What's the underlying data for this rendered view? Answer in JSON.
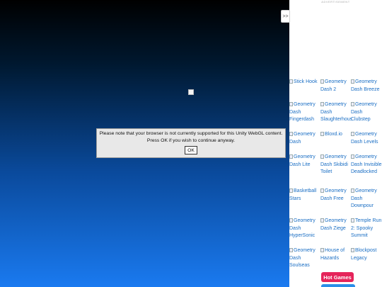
{
  "dialog": {
    "line1": "Please note that your browser is not currently supported for this Unity WebGL content.",
    "line2": "Press OK if you wish to continue anyway.",
    "ok_label": "OK"
  },
  "sidebar": {
    "toggle_label": ">>",
    "ad_label": "ADVERTISEMENT",
    "games": [
      "Stick Hook",
      "Geometry Dash 2",
      "Geometry Dash Breeze",
      "Geometry Dash Fingerdash",
      "Geometry Dash Slaughterhouse",
      "Geometry Dash Clubstep",
      "Geometry Dash",
      "Bloxd.io",
      "Geometry Dash Levels",
      "Geometry Dash Lite",
      "Geometry Dash Skibidi Toilet",
      "Geometry Dash Invisible Deadlocked",
      "Basketball Stars",
      "Geometry Dash Free",
      "Geometry Dash Downpour",
      "Geometry Dash HyperSonic",
      "Geometry Dash Ziege",
      "Temple Run 2: Spooky Summit",
      "Geometry Dash Soulseas",
      "House of Hazards",
      "Blockpost Legacy"
    ],
    "hot_games_label": "Hot Games"
  }
}
